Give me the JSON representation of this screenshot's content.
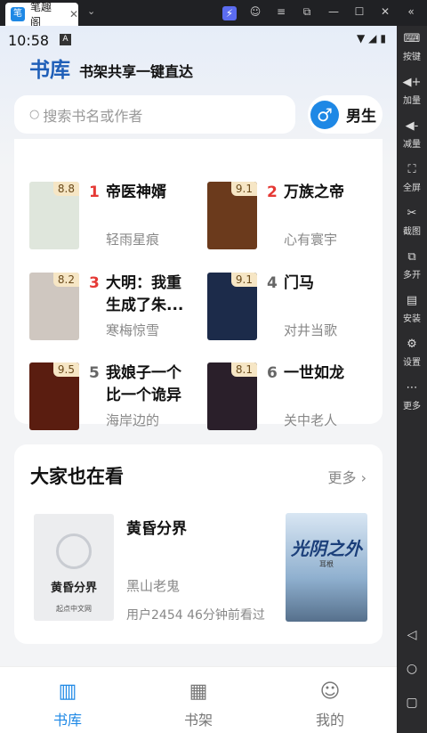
{
  "window": {
    "tab_title": "笔趣阁",
    "tab_close": "✕",
    "tab_menu": "⌄",
    "controls": [
      "⚡",
      "☺",
      "≡",
      "⧉",
      "—",
      "☐",
      "✕",
      "«"
    ]
  },
  "status_bar": {
    "time": "10:58",
    "notification_icon": "A",
    "right_icons": "▼◢▮"
  },
  "header": {
    "title": "书库",
    "subtitle": "书架共享一键直达"
  },
  "search": {
    "icon": "search-icon",
    "placeholder": "搜索书名或作者"
  },
  "gender": {
    "symbol": "♂",
    "label": "男生"
  },
  "rankings": [
    {
      "rank": "1",
      "score": "8.8",
      "title": "帝医神婿",
      "author": "轻雨星痕",
      "rank_color": "#e53935",
      "cover": "#dfe6dc"
    },
    {
      "rank": "2",
      "score": "9.1",
      "title": "万族之帝",
      "author": "心有寰宇",
      "rank_color": "#e53935",
      "cover": "#6b3a1c"
    },
    {
      "rank": "3",
      "score": "8.2",
      "title": "大明：我重生成了朱...",
      "author": "寒梅惊雪",
      "rank_color": "#e53935",
      "cover": "#cfc7c0"
    },
    {
      "rank": "4",
      "score": "9.1",
      "title": "门马",
      "author": "对井当歌",
      "rank_color": "#666666",
      "cover": "#1c2b4a"
    },
    {
      "rank": "5",
      "score": "9.5",
      "title": "我娘子一个比一个诡异",
      "author": "海岸边的",
      "rank_color": "#666666",
      "cover": "#5a1d10"
    },
    {
      "rank": "6",
      "score": "8.1",
      "title": "一世如龙",
      "author": "关中老人",
      "rank_color": "#666666",
      "cover": "#2a1f2a"
    }
  ],
  "also_watching": {
    "heading": "大家也在看",
    "more_label": "更多",
    "more_chevron": "›",
    "book_title": "黄昏分界",
    "book_author": "黑山老鬼",
    "book_stat": "用户2454 46分钟前看过",
    "left_cover_text": "黄昏分界",
    "left_cover_publisher": "起点中文网",
    "right_cover_text": "光阴之外",
    "right_cover_author": "耳根"
  },
  "bottom_nav": [
    {
      "label": "书库",
      "icon": "library-icon",
      "glyph": "▥",
      "color": "#1e88e5"
    },
    {
      "label": "书架",
      "icon": "bookshelf-icon",
      "glyph": "▦",
      "color": "#777777"
    },
    {
      "label": "我的",
      "icon": "profile-icon",
      "glyph": "☺",
      "color": "#777777"
    }
  ],
  "side_toolbar": [
    {
      "label": "按键",
      "glyph": "⌨"
    },
    {
      "label": "加量",
      "glyph": "◀+"
    },
    {
      "label": "减量",
      "glyph": "◀-"
    },
    {
      "label": "全屏",
      "glyph": "⛶"
    },
    {
      "label": "截图",
      "glyph": "✂"
    },
    {
      "label": "多开",
      "glyph": "⧉"
    },
    {
      "label": "安装",
      "glyph": "▤"
    },
    {
      "label": "设置",
      "glyph": "⚙"
    },
    {
      "label": "更多",
      "glyph": "⋯"
    }
  ],
  "side_system": [
    "◁",
    "○",
    "▢"
  ]
}
